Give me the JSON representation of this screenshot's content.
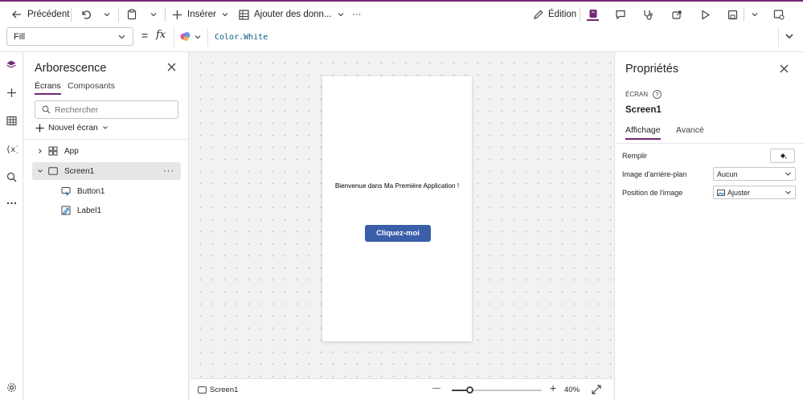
{
  "commandbar": {
    "back_label": "Précédent",
    "insert_label": "Insérer",
    "add_data_label": "Ajouter des donn...",
    "more_label": "···",
    "edit_label": "Édition"
  },
  "formula": {
    "property": "Fill",
    "fx_label": "fx",
    "equals": "=",
    "value": "Color.White"
  },
  "tree": {
    "title": "Arborescence",
    "tabs": [
      "Écrans",
      "Composants"
    ],
    "active_tab": "Écrans",
    "search_placeholder": "Rechercher",
    "new_screen_label": "Nouvel écran",
    "items": [
      {
        "label": "App",
        "icon": "app-icon"
      },
      {
        "label": "Screen1",
        "icon": "screen-icon",
        "selected": true
      },
      {
        "label": "Button1",
        "icon": "button-icon"
      },
      {
        "label": "Label1",
        "icon": "label-icon"
      }
    ],
    "row_more": "···"
  },
  "canvas": {
    "welcome_text": "Bienvenue dans Ma Première Application !",
    "button_label": "Cliquez-moi",
    "screen_name": "Screen1",
    "zoom": "40%",
    "zoom_minus": "—",
    "zoom_plus": "+"
  },
  "properties": {
    "title": "Propriétés",
    "type_label": "ÉCRAN",
    "help_symbol": "?",
    "name": "Screen1",
    "tabs": [
      "Affichage",
      "Avancé"
    ],
    "active_tab": "Affichage",
    "fill_label": "Remplir",
    "bg_image_label": "Image d'arrière-plan",
    "bg_image_value": "Aucun",
    "image_position_label": "Position de l'image",
    "image_position_value": "Ajuster"
  },
  "colors": {
    "accent": "#742774",
    "button": "#3a5fa8",
    "canvas_bg": "#f3f2f1"
  }
}
